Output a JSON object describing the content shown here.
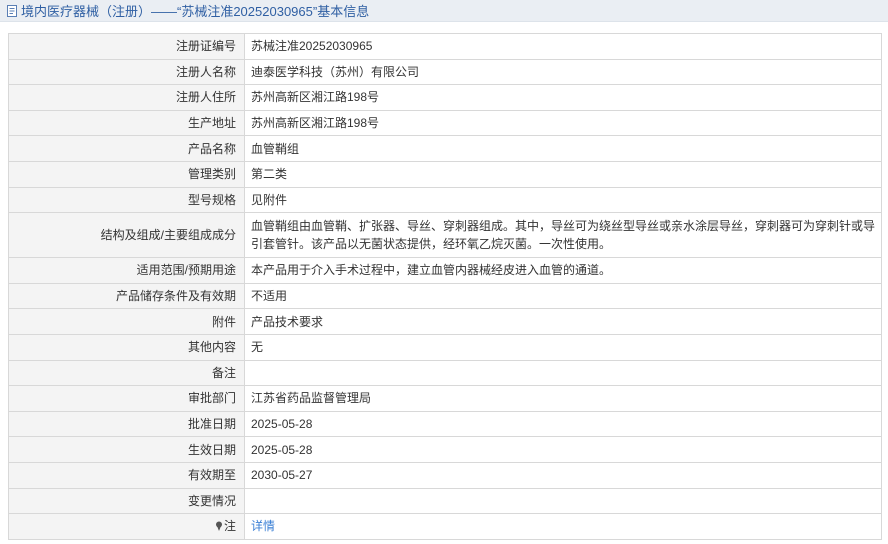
{
  "header": {
    "title": "境内医疗器械（注册）——“苏械注准20252030965”基本信息"
  },
  "rows": [
    {
      "label": "注册证编号",
      "value": "苏械注准20252030965"
    },
    {
      "label": "注册人名称",
      "value": "迪泰医学科技（苏州）有限公司"
    },
    {
      "label": "注册人住所",
      "value": "苏州高新区湘江路198号"
    },
    {
      "label": "生产地址",
      "value": "苏州高新区湘江路198号"
    },
    {
      "label": "产品名称",
      "value": "血管鞘组"
    },
    {
      "label": "管理类别",
      "value": "第二类"
    },
    {
      "label": "型号规格",
      "value": "见附件"
    },
    {
      "label": "结构及组成/主要组成成分",
      "value": "血管鞘组由血管鞘、扩张器、导丝、穿刺器组成。其中，导丝可为绕丝型导丝或亲水涂层导丝，穿刺器可为穿刺针或导引套管针。该产品以无菌状态提供，经环氧乙烷灭菌。一次性使用。"
    },
    {
      "label": "适用范围/预期用途",
      "value": "本产品用于介入手术过程中，建立血管内器械经皮进入血管的通道。"
    },
    {
      "label": "产品储存条件及有效期",
      "value": "不适用"
    },
    {
      "label": "附件",
      "value": "产品技术要求"
    },
    {
      "label": "其他内容",
      "value": "无"
    },
    {
      "label": "备注",
      "value": ""
    },
    {
      "label": "审批部门",
      "value": "江苏省药品监督管理局"
    },
    {
      "label": "批准日期",
      "value": "2025-05-28"
    },
    {
      "label": "生效日期",
      "value": "2025-05-28"
    },
    {
      "label": "有效期至",
      "value": "2030-05-27"
    },
    {
      "label": "变更情况",
      "value": ""
    }
  ],
  "note_row": {
    "label": "注",
    "link_text": "详情"
  },
  "colors": {
    "header_bg": "#eaeef3",
    "header_text": "#2f5fa3",
    "label_bg": "#f4f4f4",
    "border": "#d8d8d8",
    "link": "#3a7fd5"
  },
  "icons": {
    "header": "document-icon",
    "note": "pin-icon"
  }
}
